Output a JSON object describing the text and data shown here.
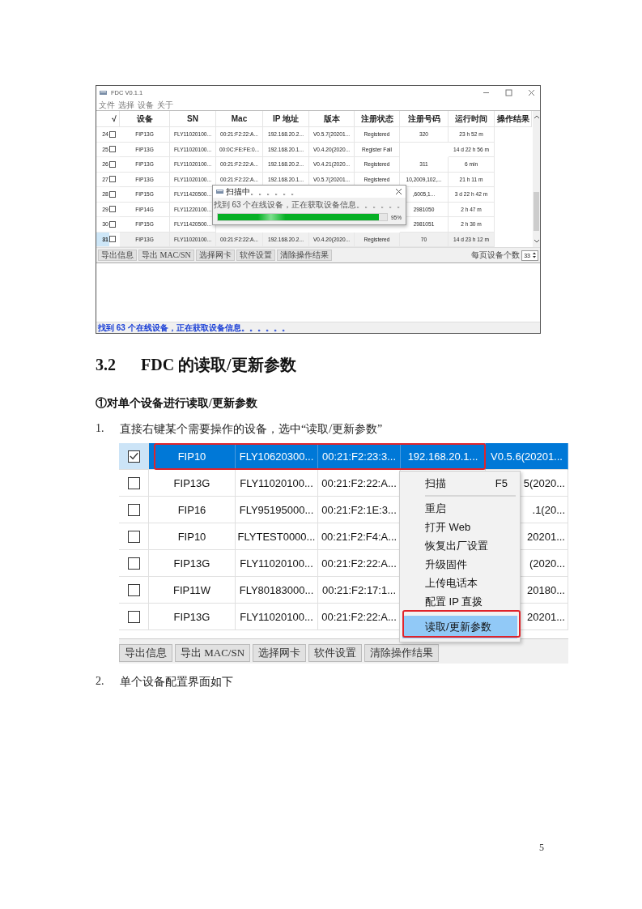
{
  "screenshot_1": {
    "window": {
      "title": "FDC  V0.1.1"
    },
    "menu": [
      "文件",
      "选择",
      "设备",
      "关于"
    ],
    "table": {
      "check_header": "√",
      "columns": [
        "设备",
        "SN",
        "Mac",
        "IP 地址",
        "版本",
        "注册状态",
        "注册号码",
        "运行时间",
        "操作结果"
      ],
      "rows": [
        {
          "number": "24",
          "checked": false,
          "selected": false,
          "cells": [
            "FIP13G",
            "FLY11020100...",
            "00:21:F2:22:A...",
            "192.168.20.2...",
            "V0.5.7(20201...",
            "Registered",
            "320",
            "23 h 52 m"
          ]
        },
        {
          "number": "25",
          "checked": false,
          "selected": false,
          "cells": [
            "FIP13G",
            "FLY11020100...",
            "00:0C:FE:FE:0...",
            "192.168.20.1...",
            "V0.4.20(2020...",
            "Register Fail",
            null,
            "14 d 22 h 56 m"
          ]
        },
        {
          "number": "26",
          "checked": false,
          "selected": false,
          "cells": [
            "FIP13G",
            "FLY11020100...",
            "00:21:F2:22:A...",
            "192.168.20.2...",
            "V0.4.21(2020...",
            "Registered",
            "311",
            "6 min"
          ]
        },
        {
          "number": "27",
          "checked": false,
          "selected": false,
          "cells": [
            "FIP13G",
            "FLY11020100...",
            "00:21:F2:22:A...",
            "192.168.20.1...",
            "V0.5.7(20201...",
            "Registered",
            "10,2009,102,...",
            "21 h 11 m"
          ]
        },
        {
          "number": "28",
          "checked": false,
          "selected": false,
          "cells": [
            "FIP15G",
            "FLY11420500...",
            null,
            null,
            null,
            null,
            ",6005,1...",
            "3 d 22 h 42 m"
          ]
        },
        {
          "number": "29",
          "checked": false,
          "selected": false,
          "cells": [
            "FIP14G",
            "FLY11220100...",
            null,
            null,
            null,
            null,
            "2981050",
            "2 h 47 m"
          ]
        },
        {
          "number": "30",
          "checked": false,
          "selected": false,
          "cells": [
            "FIP15G",
            "FLY11420500...",
            null,
            null,
            null,
            null,
            "2981051",
            "2 h 30 m"
          ]
        },
        {
          "number": "31",
          "checked": false,
          "selected": true,
          "cells": [
            "FIP13G",
            "FLY11020100...",
            "00:21:F2:22:A...",
            "192.168.20.2...",
            "V0.4.20(2020...",
            "Registered",
            "70",
            "14 d 23 h 12 m"
          ]
        }
      ]
    },
    "buttons": [
      "导出信息",
      "导出 MAC/SN",
      "选择网卡",
      "软件设置",
      "清除操作结果"
    ],
    "page_size": {
      "label": "每页设备个数",
      "value": "33"
    },
    "status": "找到 63 个在线设备，正在获取设备信息。。。。。。",
    "dialog": {
      "title": "扫描中。。。。。。",
      "message": "找到 63 个在线设备，正在获取设备信息。。。。。。",
      "level": 0.95,
      "reading": "95%"
    }
  },
  "section": {
    "number": "3.2",
    "title": "FDC 的读取/更新参数"
  },
  "subheading": "①对单个设备进行读取/更新参数",
  "steps": [
    {
      "number": "1.",
      "text": "直接右键某个需要操作的设备，选中“读取/更新参数”"
    }
  ],
  "screenshot_2": {
    "rows": [
      {
        "checked": true,
        "selected": true,
        "cells": [
          "FIP10",
          "FLY10620300...",
          "00:21:F2:23:3...",
          "192.168.20.1...",
          "V0.5.6(20201..."
        ]
      },
      {
        "checked": false,
        "selected": false,
        "cells": [
          "FIP13G",
          "FLY11020100...",
          "00:21:F2:22:A...",
          null,
          "5(2020..."
        ]
      },
      {
        "checked": false,
        "selected": false,
        "cells": [
          "FIP16",
          "FLY95195000...",
          "00:21:F2:1E:3...",
          null,
          ".1(20..."
        ]
      },
      {
        "checked": false,
        "selected": false,
        "cells": [
          "FIP10",
          "FLYTEST0000...",
          "00:21:F2:F4:A...",
          null,
          "20201..."
        ]
      },
      {
        "checked": false,
        "selected": false,
        "cells": [
          "FIP13G",
          "FLY11020100...",
          "00:21:F2:22:A...",
          null,
          "(2020..."
        ]
      },
      {
        "checked": false,
        "selected": false,
        "cells": [
          "FIP11W",
          "FLY80183000...",
          "00:21:F2:17:1...",
          null,
          "20180..."
        ]
      },
      {
        "checked": false,
        "selected": false,
        "cells": [
          "FIP13G",
          "FLY11020100...",
          "00:21:F2:22:A...",
          null,
          "20201..."
        ]
      }
    ],
    "context_menu": [
      {
        "label": "扫描",
        "shortcut": "F5",
        "selected": false,
        "separator_after": true
      },
      {
        "label": "重启",
        "selected": false
      },
      {
        "label": "打开 Web",
        "selected": false
      },
      {
        "label": "恢复出厂设置",
        "selected": false
      },
      {
        "label": "升级固件",
        "selected": false
      },
      {
        "label": "上传电话本",
        "selected": false
      },
      {
        "label": "配置 IP 直拨",
        "selected": false
      },
      {
        "label": "读取/更新参数",
        "selected": true
      }
    ],
    "buttons": [
      "导出信息",
      "导出 MAC/SN",
      "选择网卡",
      "软件设置",
      "清除操作结果"
    ]
  },
  "steps_2": [
    {
      "number": "2.",
      "text": "单个设备配置界面如下"
    }
  ],
  "page_number": "5"
}
